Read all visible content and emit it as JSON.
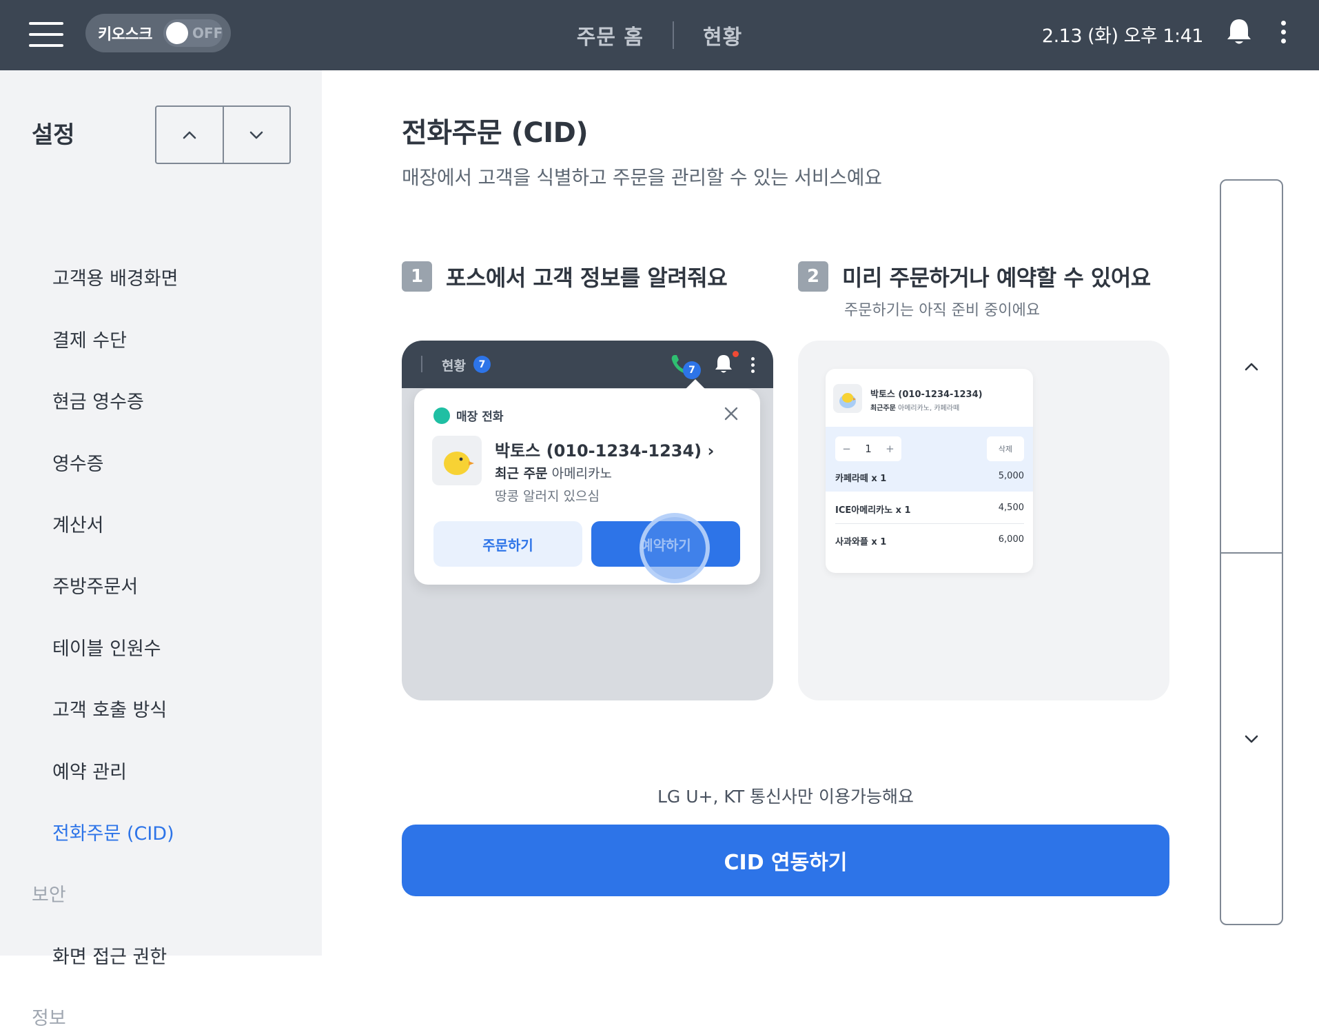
{
  "header": {
    "kiosk_label": "키오스크",
    "kiosk_state": "OFF",
    "nav": [
      "주문 홈",
      "현황"
    ],
    "datetime": "2.13 (화) 오후 1:41"
  },
  "sidebar": {
    "title": "설정",
    "items": [
      {
        "label": "고객용 배경화면"
      },
      {
        "label": "결제 수단"
      },
      {
        "label": "현금 영수증"
      },
      {
        "label": "영수증"
      },
      {
        "label": "계산서"
      },
      {
        "label": "주방주문서"
      },
      {
        "label": "테이블 인원수"
      },
      {
        "label": "고객 호출 방식"
      },
      {
        "label": "예약 관리"
      },
      {
        "label": "전화주문 (CID)",
        "active": true
      }
    ],
    "sections": [
      {
        "label": "보안",
        "items": [
          {
            "label": "화면 접근 권한"
          }
        ]
      },
      {
        "label": "정보"
      }
    ]
  },
  "main": {
    "title": "전화주문 (CID)",
    "description": "매장에서 고객을 식별하고 주문을 관리할 수 있는 서비스예요",
    "step1": {
      "num": "1",
      "text": "포스에서 고객 정보를 알려줘요"
    },
    "step2": {
      "num": "2",
      "text": "미리 주문하거나 예약할 수 있어요",
      "sub": "주문하기는 아직 준비 중이에요"
    },
    "card1": {
      "bar_label": "현황",
      "bar_badge": "7",
      "phone_badge": "7",
      "popup": {
        "head": "매장 전화",
        "name": "박토스 (010-1234-1234) ›",
        "recent_label": "최근 주문",
        "recent_value": "아메리카노",
        "note": "땅콩 알러지 있으심",
        "order_button": "주문하기",
        "reserve_button": "예약하기"
      }
    },
    "card2": {
      "name": "박토스 (010-1234-1234)",
      "recent_label": "최근주문",
      "recent_value": "아메리카노, 카페라떼",
      "qty": "1",
      "delete": "삭제",
      "rows": [
        {
          "name": "카페라떼 x 1",
          "price": "5,000"
        },
        {
          "name": "ICE아메리카노 x 1",
          "price": "4,500"
        },
        {
          "name": "사과와플 x 1",
          "price": "6,000"
        }
      ]
    },
    "carrier_note": "LG U+, KT 통신사만 이용가능해요",
    "cid_button": "CID 연동하기"
  },
  "colors": {
    "header_bg": "#3c4653",
    "accent": "#2d74e8",
    "sidebar_bg": "#f2f3f5"
  },
  "icons": {
    "menu": "hamburger-icon",
    "bell": "bell-icon",
    "more": "kebab-icon",
    "up": "chevron-up-icon",
    "down": "chevron-down-icon",
    "close": "close-icon",
    "phone": "phone-icon"
  }
}
